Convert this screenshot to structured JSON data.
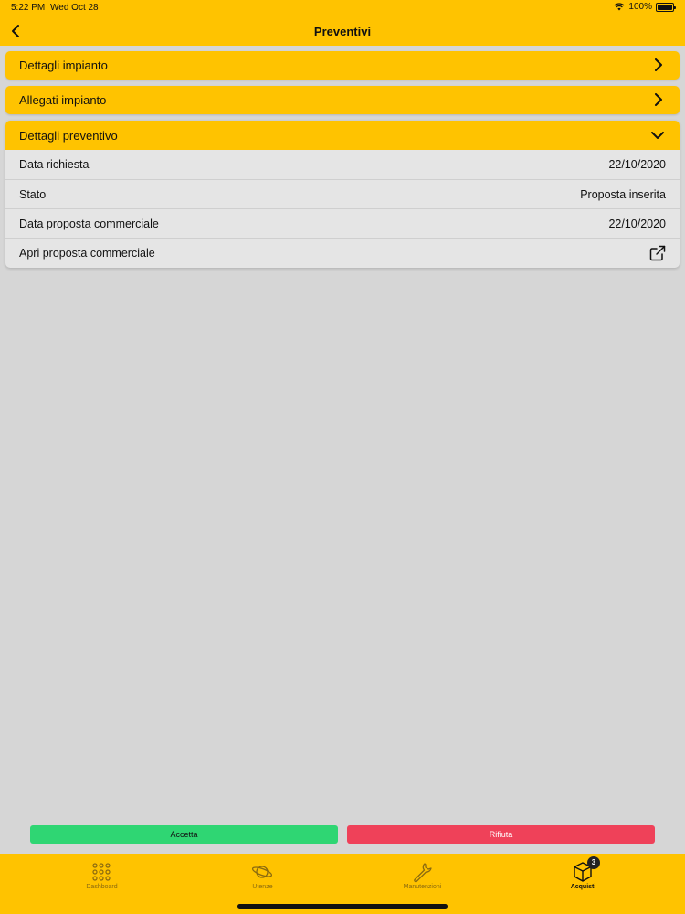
{
  "status_bar": {
    "time": "5:22 PM",
    "date": "Wed Oct 28",
    "battery": "100%"
  },
  "header": {
    "title": "Preventivi",
    "back_icon": "chevron-left-icon"
  },
  "sections": [
    {
      "label": "Dettagli impianto",
      "icon": "chevron-right-icon"
    },
    {
      "label": "Allegati impianto",
      "icon": "chevron-right-icon"
    }
  ],
  "preventivo": {
    "label": "Dettagli preventivo",
    "icon": "chevron-down-icon",
    "rows": [
      {
        "key": "Data richiesta",
        "value": "22/10/2020"
      },
      {
        "key": "Stato",
        "value": "Proposta inserita"
      },
      {
        "key": "Data proposta commerciale",
        "value": "22/10/2020"
      },
      {
        "key": "Apri proposta commerciale",
        "icon": "external-link-icon"
      }
    ]
  },
  "actions": {
    "accept": "Accetta",
    "reject": "Rifiuta"
  },
  "tabs": [
    {
      "label": "Dashboard",
      "icon": "grid-dots-icon"
    },
    {
      "label": "Utenze",
      "icon": "planet-icon"
    },
    {
      "label": "Manutenzioni",
      "icon": "wrench-icon"
    },
    {
      "label": "Acquisti",
      "icon": "box-icon",
      "badge": "3",
      "active": true
    }
  ],
  "colors": {
    "primary": "#ffc300",
    "background": "#d6d6d6",
    "accept": "#2fd673",
    "reject": "#ef4159"
  }
}
